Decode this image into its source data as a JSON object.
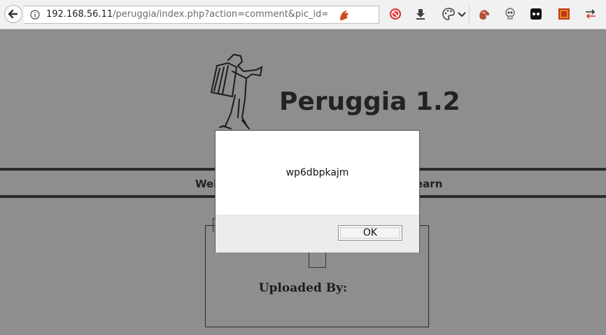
{
  "browser": {
    "url_host": "192.168.56.11",
    "url_path": "/peruggia/index.php?action=comment&pic_id=:",
    "icons": [
      "back-arrow-icon",
      "info-icon",
      "firebug-extension-icon",
      "no-script-icon",
      "download-icon",
      "palette-icon",
      "chevron-down-icon",
      "hand-extension-icon",
      "skull-extension-icon",
      "tab-extension-icon",
      "red-square-extension-icon",
      "sidebar-arrows-icon"
    ]
  },
  "page": {
    "title": "Peruggia 1.2",
    "nav_left_fragment": "Wel",
    "nav_right_fragment": "earn",
    "uploaded_by_label": "Uploaded By:"
  },
  "dialog": {
    "message": "wp6dbpkajm",
    "ok_label": "OK"
  },
  "colors": {
    "overlay_gray": "#8e8e90",
    "toolbar": "#f1f1f1",
    "dialog_bg": "#ffffff",
    "dialog_footer": "#ececec"
  }
}
